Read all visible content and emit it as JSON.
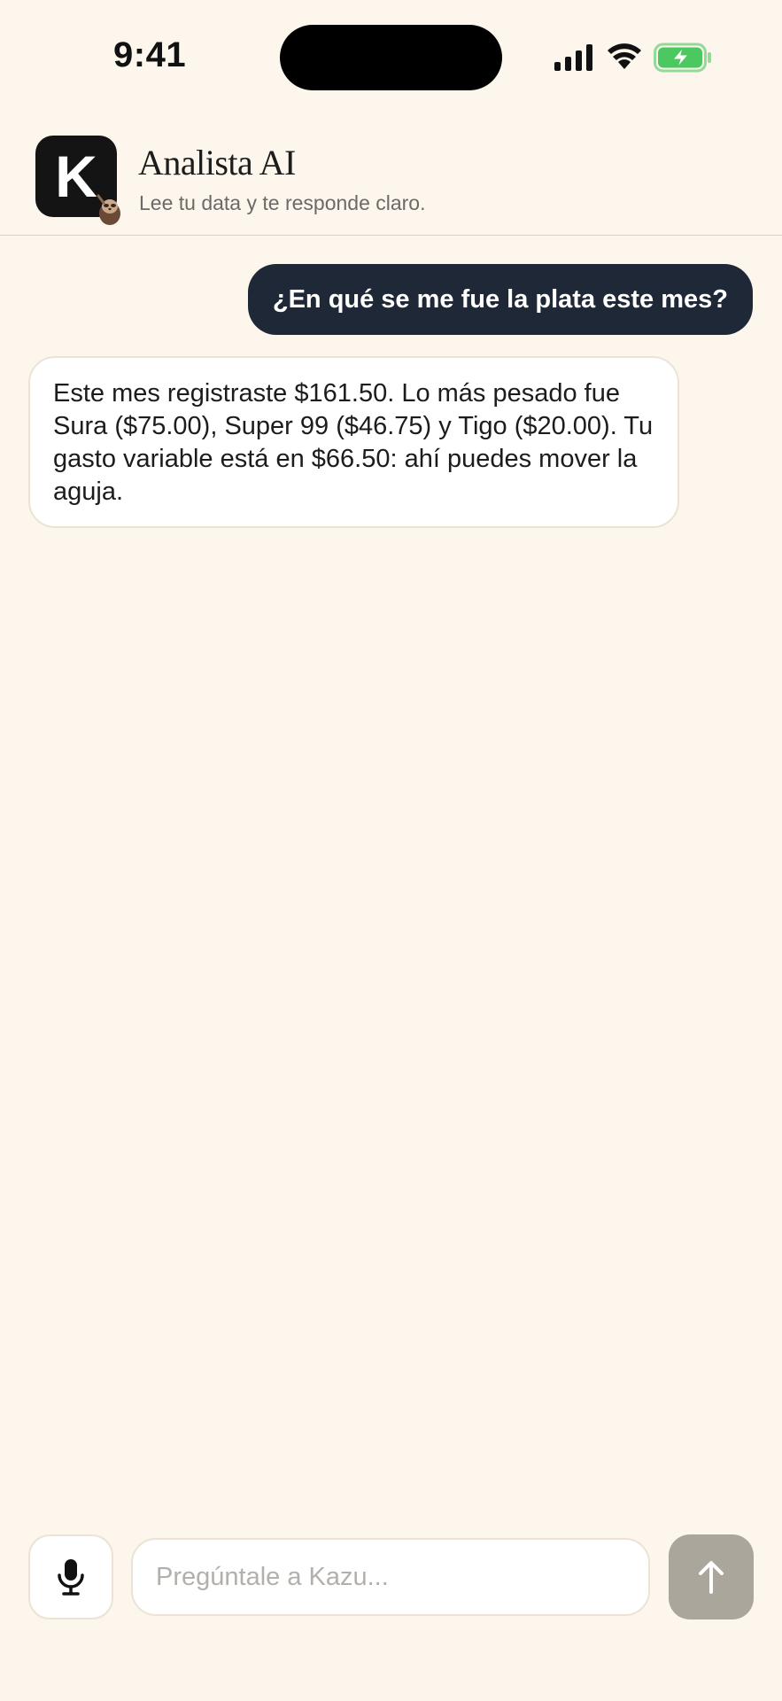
{
  "status_bar": {
    "time": "9:41",
    "icons": [
      "signal-icon",
      "wifi-icon",
      "battery-charging-icon"
    ]
  },
  "header": {
    "app_icon_letter": "K",
    "title": "Analista AI",
    "subtitle": "Lee tu data y te responde claro."
  },
  "messages": [
    {
      "role": "user",
      "text": "¿En qué se me fue la plata este mes?"
    },
    {
      "role": "assistant",
      "text": "Este mes registraste $161.50. Lo más pesado fue Sura ($75.00), Super 99 ($46.75) y Tigo ($20.00). Tu gasto variable está en $66.50: ahí puedes mover la aguja."
    }
  ],
  "composer": {
    "placeholder": "Pregúntale a Kazu...",
    "value": ""
  },
  "colors": {
    "background": "#fcf6ec",
    "user_bubble": "#1e2836",
    "assistant_bubble": "#ffffff",
    "send_button": "#aba69c",
    "battery_fill": "#4cc860"
  }
}
